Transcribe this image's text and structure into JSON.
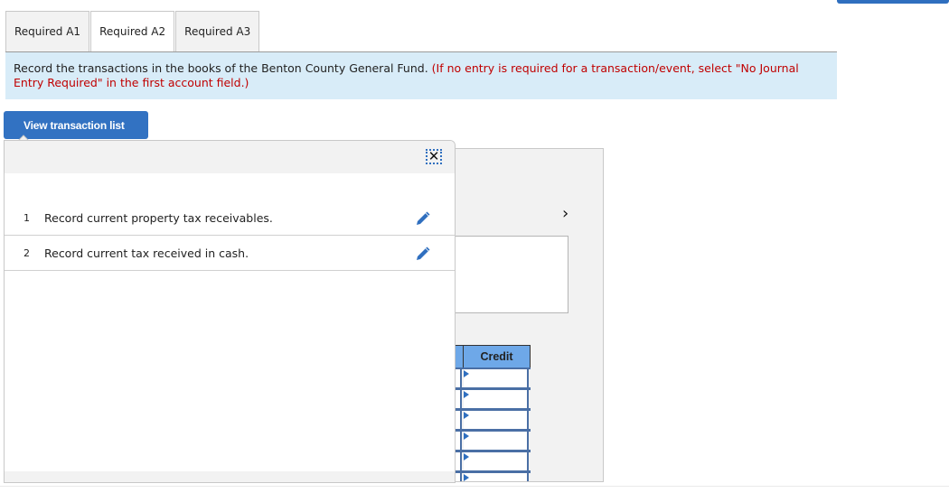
{
  "tabs": [
    {
      "label": "Required A1",
      "active": false
    },
    {
      "label": "Required A2",
      "active": true
    },
    {
      "label": "Required A3",
      "active": false
    }
  ],
  "instructions": {
    "main": "Record the transactions in the books of the Benton County General Fund.",
    "note": "(If no entry is required for a transaction/event, select \"No Journal Entry Required\" in the first account field.)"
  },
  "view_button": {
    "label": "View transaction list"
  },
  "transaction_popup": {
    "close_icon": "close-icon",
    "transactions": [
      {
        "number": "1",
        "text": "Record current property tax receivables.",
        "icon": "pencil-icon"
      },
      {
        "number": "2",
        "text": "Record current tax received in cash.",
        "icon": "pencil-icon"
      }
    ]
  },
  "panel": {
    "next_icon": "chevron-right-icon",
    "next_glyph": "›"
  },
  "journal_grid": {
    "credit_header": "Credit",
    "rows": 6
  },
  "colors": {
    "accent": "#3272c2",
    "instruction_bg": "#d8ecf8",
    "note_red": "#c00000",
    "grid_header": "#6ea8e8"
  }
}
